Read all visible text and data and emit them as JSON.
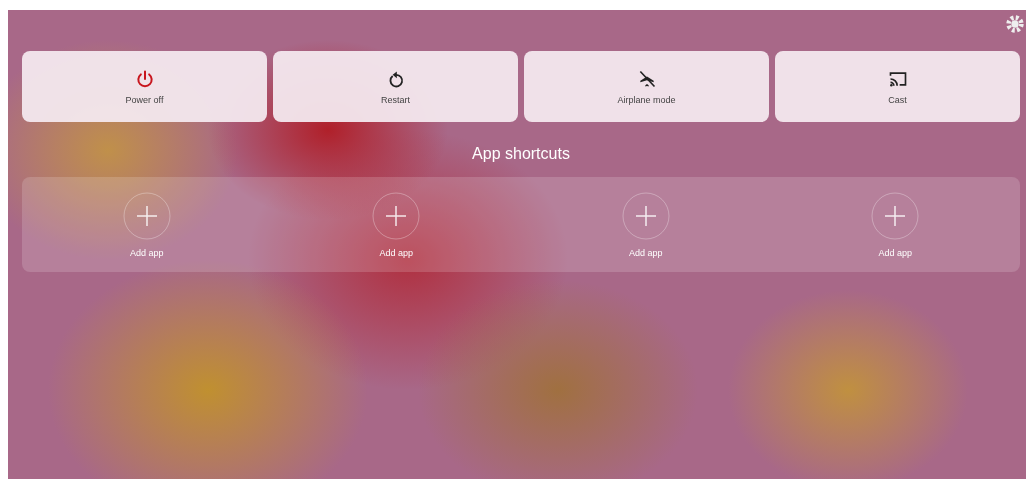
{
  "actions": [
    {
      "kind": "power",
      "label": "Power off"
    },
    {
      "kind": "restart",
      "label": "Restart"
    },
    {
      "kind": "airplane",
      "label": "Airplane mode"
    },
    {
      "kind": "cast",
      "label": "Cast"
    }
  ],
  "shortcuts": {
    "title": "App shortcuts",
    "items": [
      {
        "label": "Add app"
      },
      {
        "label": "Add app"
      },
      {
        "label": "Add app"
      },
      {
        "label": "Add app"
      }
    ]
  }
}
